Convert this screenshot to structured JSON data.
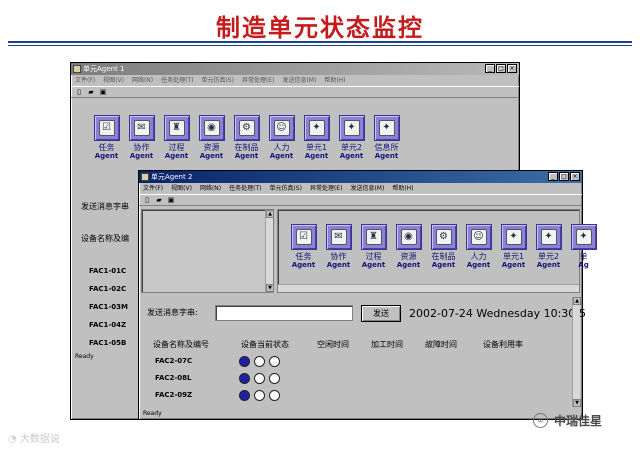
{
  "slide": {
    "title": "制造单元状态监控"
  },
  "window1": {
    "title": "单元Agent 1",
    "menu": [
      "文件(F)",
      "视图(V)",
      "网络(N)",
      "任务处理(T)",
      "单元仿真(S)",
      "异常处理(E)",
      "发送信息(M)",
      "帮助(H)"
    ],
    "agents": [
      {
        "label": "任务",
        "sub": "Agent",
        "icon": "☑"
      },
      {
        "label": "协作",
        "sub": "Agent",
        "icon": "✉"
      },
      {
        "label": "过程",
        "sub": "Agent",
        "icon": "♜"
      },
      {
        "label": "资源",
        "sub": "Agent",
        "icon": "◉"
      },
      {
        "label": "在制品",
        "sub": "Agent",
        "icon": "⚙"
      },
      {
        "label": "人力",
        "sub": "Agent",
        "icon": "☺"
      },
      {
        "label": "单元1",
        "sub": "Agent",
        "icon": "✦"
      },
      {
        "label": "单元2",
        "sub": "Agent",
        "icon": "✦"
      },
      {
        "label": "信息所",
        "sub": "Agent",
        "icon": "✦"
      }
    ],
    "send_label": "发送消息字串",
    "device_label": "设备名称及编",
    "devices": [
      "FAC1-01C",
      "FAC1-02C",
      "FAC1-03M",
      "FAC1-04Z",
      "FAC1-05B"
    ],
    "status": "Ready"
  },
  "window2": {
    "title": "单元Agent 2",
    "menu": [
      "文件(F)",
      "视图(V)",
      "网络(N)",
      "任务处理(T)",
      "单元仿真(S)",
      "异常处理(E)",
      "发送信息(M)",
      "帮助(H)"
    ],
    "agents": [
      {
        "label": "任务",
        "sub": "Agent",
        "icon": "☑"
      },
      {
        "label": "协作",
        "sub": "Agent",
        "icon": "✉"
      },
      {
        "label": "过程",
        "sub": "Agent",
        "icon": "♜"
      },
      {
        "label": "资源",
        "sub": "Agent",
        "icon": "◉"
      },
      {
        "label": "在制品",
        "sub": "Agent",
        "icon": "⚙"
      },
      {
        "label": "人力",
        "sub": "Agent",
        "icon": "☺"
      },
      {
        "label": "单元1",
        "sub": "Agent",
        "icon": "✦"
      },
      {
        "label": "单元2",
        "sub": "Agent",
        "icon": "✦"
      },
      {
        "label": "单",
        "sub": "Ag",
        "icon": "✦"
      }
    ],
    "send_label": "发送消息字串:",
    "send_button": "发送",
    "datetime": "2002-07-24 Wednesday 10:30:5",
    "columns": [
      "设备名称及编号",
      "设备当前状态",
      "空闲时间",
      "加工时间",
      "故障时间",
      "设备利用率"
    ],
    "devices": [
      {
        "name": "FAC2-07C",
        "lamps": [
          1,
          0,
          0
        ]
      },
      {
        "name": "FAC2-08L",
        "lamps": [
          1,
          0,
          0
        ]
      },
      {
        "name": "FAC2-09Z",
        "lamps": [
          1,
          0,
          0
        ]
      }
    ],
    "status": "Ready"
  },
  "watermarks": {
    "left": "大数据说",
    "right": "中瑞佳星"
  }
}
